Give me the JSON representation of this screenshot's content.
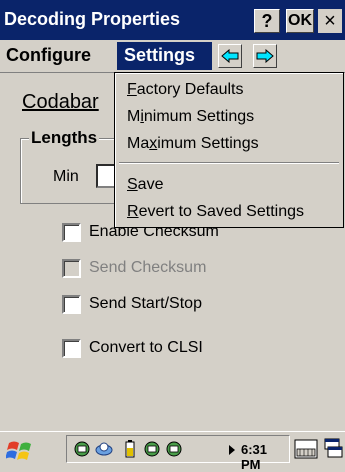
{
  "window": {
    "title": "Decoding Properties",
    "help_label": "?",
    "ok_label": "OK",
    "close_label": "×"
  },
  "menubar": {
    "configure_label": "Configure",
    "settings_label": "Settings"
  },
  "dropdown": {
    "items": [
      {
        "label": "Factory Defaults",
        "accel": "F",
        "rest": "actory Defaults"
      },
      {
        "label": "Minimum Settings",
        "pre": "M",
        "accel": "i",
        "rest": "nimum Settings"
      },
      {
        "label": "Maximum Settings",
        "pre": "Ma",
        "accel": "x",
        "rest": "imum Settings"
      },
      {
        "label": "Save",
        "accel": "S",
        "rest": "ave"
      },
      {
        "label": "Revert to Saved Settings",
        "accel": "R",
        "rest": "evert to Saved Settings"
      }
    ]
  },
  "content": {
    "page_title": "Codabar",
    "lengths_label": "Lengths",
    "min_label": "Min",
    "checkboxes": [
      {
        "label": "Enable Checksum",
        "checked": false,
        "enabled": true
      },
      {
        "label": "Send Checksum",
        "checked": false,
        "enabled": false
      },
      {
        "label": "Send Start/Stop",
        "checked": false,
        "enabled": true
      },
      {
        "label": "Convert to CLSI",
        "checked": false,
        "enabled": true
      }
    ]
  },
  "taskbar": {
    "clock": "6:31 PM",
    "icons": [
      "start-icon",
      "network-icon",
      "sync-icon",
      "battery-icon",
      "network-icon-2",
      "network-icon-3",
      "keyboard-icon",
      "windows-icon"
    ]
  }
}
